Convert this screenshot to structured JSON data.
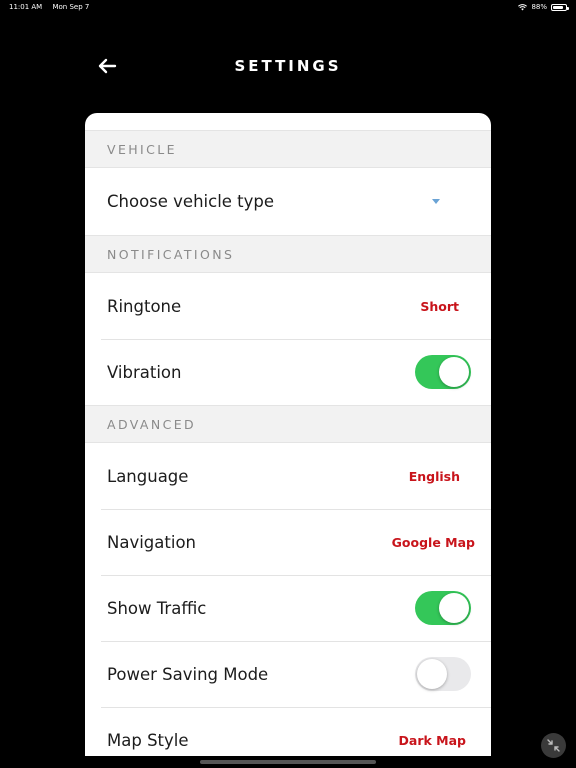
{
  "status_bar": {
    "time": "11:01 AM",
    "date": "Mon Sep 7",
    "battery": "88%",
    "battery_level": 0.88
  },
  "header": {
    "title": "SETTINGS",
    "back_icon": "arrow-left-icon"
  },
  "sections": {
    "vehicle": {
      "title": "VEHICLE",
      "vehicle_type": {
        "label": "Choose vehicle type"
      }
    },
    "notifications": {
      "title": "NOTIFICATIONS",
      "ringtone": {
        "label": "Ringtone",
        "value": "Short"
      },
      "vibration": {
        "label": "Vibration",
        "on": true
      }
    },
    "advanced": {
      "title": "ADVANCED",
      "language": {
        "label": "Language",
        "value": "English"
      },
      "navigation": {
        "label": "Navigation",
        "value": "Google Map"
      },
      "show_traffic": {
        "label": "Show Traffic",
        "on": true
      },
      "power_saving": {
        "label": "Power Saving Mode",
        "on": false
      },
      "map_style": {
        "label": "Map Style",
        "value": "Dark Map"
      }
    }
  },
  "colors": {
    "accent_value": "#c8141b",
    "toggle_on": "#34c759",
    "toggle_off": "#e9e9eb",
    "caret": "#6aa3d5"
  }
}
